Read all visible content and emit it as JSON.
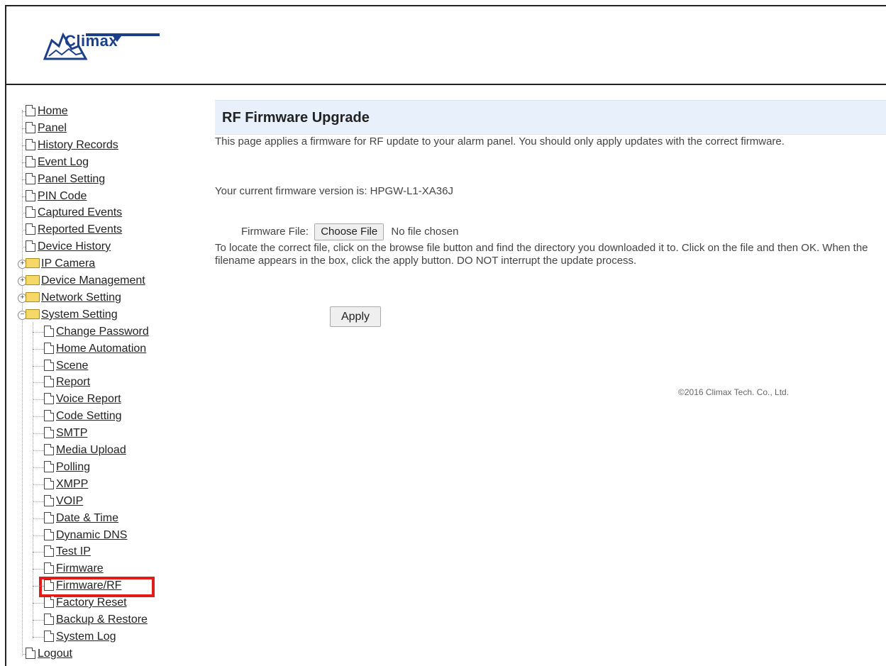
{
  "header": {
    "logo_text": "Climax"
  },
  "sidebar": {
    "items": [
      {
        "label": "Home",
        "type": "doc",
        "level": 0
      },
      {
        "label": "Panel",
        "type": "doc",
        "level": 0
      },
      {
        "label": "History Records",
        "type": "doc",
        "level": 0
      },
      {
        "label": "Event Log",
        "type": "doc",
        "level": 0
      },
      {
        "label": "Panel Setting",
        "type": "doc",
        "level": 0
      },
      {
        "label": "PIN Code",
        "type": "doc",
        "level": 0
      },
      {
        "label": "Captured Events",
        "type": "doc",
        "level": 0
      },
      {
        "label": "Reported Events",
        "type": "doc",
        "level": 0
      },
      {
        "label": "Device History",
        "type": "doc",
        "level": 0
      },
      {
        "label": "IP Camera",
        "type": "folder",
        "level": 0,
        "expander": "+"
      },
      {
        "label": "Device Management",
        "type": "folder",
        "level": 0,
        "expander": "+"
      },
      {
        "label": "Network Setting",
        "type": "folder",
        "level": 0,
        "expander": "+"
      },
      {
        "label": "System Setting",
        "type": "folder-open",
        "level": 0,
        "expander": "-"
      },
      {
        "label": "Change Password",
        "type": "doc",
        "level": 1
      },
      {
        "label": "Home Automation",
        "type": "doc",
        "level": 1
      },
      {
        "label": "Scene",
        "type": "doc",
        "level": 1
      },
      {
        "label": "Report",
        "type": "doc",
        "level": 1
      },
      {
        "label": "Voice Report",
        "type": "doc",
        "level": 1
      },
      {
        "label": "Code Setting",
        "type": "doc",
        "level": 1
      },
      {
        "label": "SMTP",
        "type": "doc",
        "level": 1
      },
      {
        "label": "Media Upload",
        "type": "doc",
        "level": 1
      },
      {
        "label": "Polling",
        "type": "doc",
        "level": 1
      },
      {
        "label": "XMPP",
        "type": "doc",
        "level": 1
      },
      {
        "label": "VOIP",
        "type": "doc",
        "level": 1
      },
      {
        "label": "Date & Time",
        "type": "doc",
        "level": 1
      },
      {
        "label": "Dynamic DNS",
        "type": "doc",
        "level": 1
      },
      {
        "label": "Test IP",
        "type": "doc",
        "level": 1
      },
      {
        "label": "Firmware",
        "type": "doc",
        "level": 1
      },
      {
        "label": "Firmware/RF",
        "type": "doc",
        "level": 1,
        "selected": true
      },
      {
        "label": "Factory Reset",
        "type": "doc",
        "level": 1
      },
      {
        "label": "Backup & Restore",
        "type": "doc",
        "level": 1
      },
      {
        "label": "System Log",
        "type": "doc",
        "level": 1
      },
      {
        "label": "Logout",
        "type": "doc",
        "level": 0
      }
    ]
  },
  "main": {
    "title": "RF Firmware Upgrade",
    "description": "This page applies a firmware for RF update to your alarm panel. You should only apply updates with the correct firmware.",
    "version_text": "Your current firmware version is: HPGW-L1-XA36J",
    "firmware_label": "Firmware File:",
    "choose_file_label": "Choose File",
    "no_file_text": "No file chosen",
    "help_text": "To locate the correct file, click on the browse file button and find the directory you downloaded it to. Click on the file and then OK. When the filename appears in the box, click the apply button. DO NOT interrupt the update process.",
    "apply_label": "Apply",
    "copyright": "©2016 Climax Tech. Co., Ltd."
  },
  "colors": {
    "highlight": "#e41b1b",
    "title_bg": "#e8f0fb",
    "logo": "#1c3f8a"
  }
}
